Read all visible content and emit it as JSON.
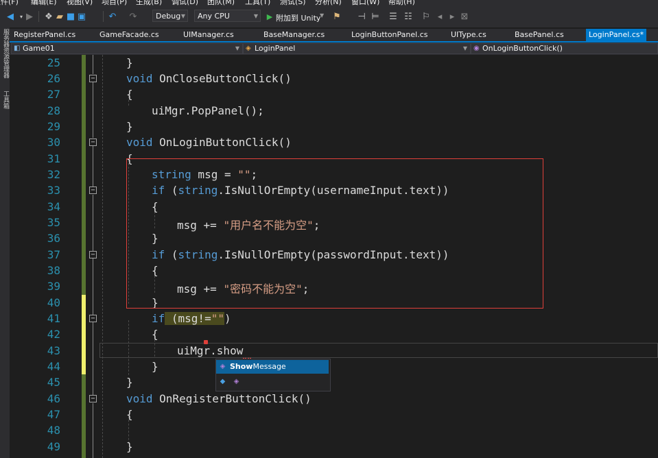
{
  "menubar": [
    "文件(F)",
    "编辑(E)",
    "视图(V)",
    "项目(P)",
    "生成(B)",
    "调试(D)",
    "团队(M)",
    "工具(T)",
    "测试(S)",
    "分析(N)",
    "窗口(W)",
    "帮助(H)"
  ],
  "toolbar": {
    "configuration": "Debug",
    "platform": "Any CPU",
    "attach_label": "附加到 Unity"
  },
  "rail": [
    "服务器资源管理器",
    "工具箱"
  ],
  "tabs": [
    "RegisterPanel.cs",
    "GameFacade.cs",
    "UIManager.cs",
    "BaseManager.cs",
    "LoginButtonPanel.cs",
    "UIType.cs",
    "BasePanel.cs",
    "LoginPanel.cs*"
  ],
  "active_tab": "LoginPanel.cs*",
  "navbar": {
    "project": "Game01",
    "class": "LoginPanel",
    "member": "OnLoginButtonClick()"
  },
  "line_numbers": [
    "25",
    "26",
    "27",
    "28",
    "29",
    "30",
    "31",
    "32",
    "33",
    "34",
    "35",
    "36",
    "37",
    "38",
    "39",
    "40",
    "41",
    "42",
    "43",
    "44",
    "45",
    "46",
    "47",
    "48",
    "49"
  ],
  "code": {
    "l25": "}",
    "l26_kw": "void",
    "l26_rest": " OnCloseButtonClick()",
    "l27": "{",
    "l28": "uiMgr.PopPanel();",
    "l29": "}",
    "l30_kw": "void",
    "l30_rest": " OnLoginButtonClick()",
    "l31": "{",
    "l32_kw": "string",
    "l32_mid": " msg = ",
    "l32_str": "\"\"",
    "l32_end": ";",
    "l33_kw": "if",
    "l33_a": " (",
    "l33_kw2": "string",
    "l33_rest": ".IsNullOrEmpty(usernameInput.text))",
    "l34": "{",
    "l35_a": "msg += ",
    "l35_str": "\"用户名不能为空\"",
    "l35_end": ";",
    "l36": "}",
    "l37_kw": "if",
    "l37_a": " (",
    "l37_kw2": "string",
    "l37_rest": ".IsNullOrEmpty(passwordInput.text))",
    "l38": "{",
    "l39_a": "msg += ",
    "l39_str": "\"密码不能为空\"",
    "l39_end": ";",
    "l40": "}",
    "l41_kw": "if",
    "l41_a": " (msg!=",
    "l41_str": "\"\"",
    "l41_end": ")",
    "l42": "{",
    "l43": "uiMgr.show",
    "l44": "}",
    "l45": "}",
    "l46_kw": "void",
    "l46_rest": " OnRegisterButtonClick()",
    "l47": "{",
    "l49": "}"
  },
  "intellisense": {
    "match": "Show",
    "rest": "Message"
  },
  "colors": {
    "keyword": "#569cd6",
    "string": "#d69d85",
    "line_number": "#2b91af",
    "accent": "#007acc",
    "highlight_box": "#e0403a"
  }
}
